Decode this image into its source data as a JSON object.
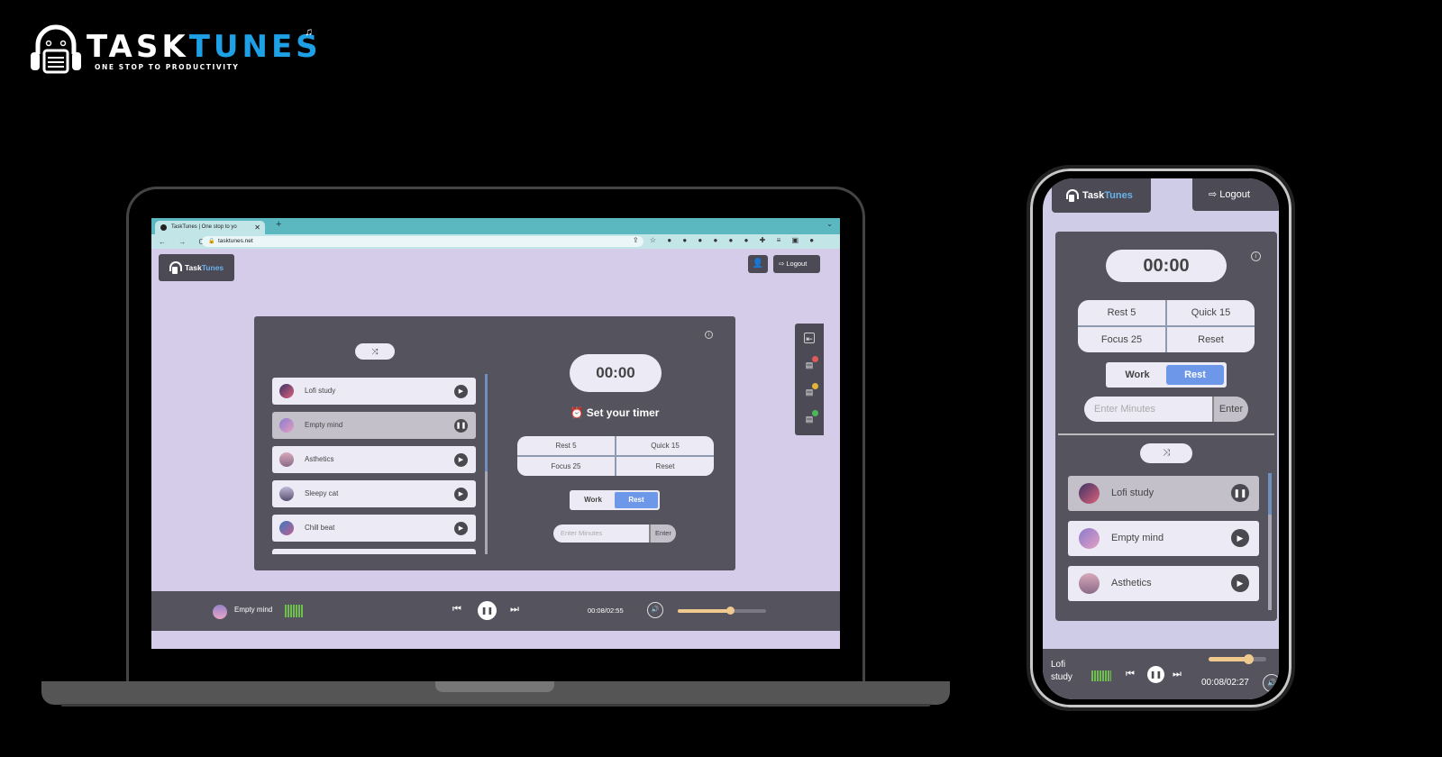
{
  "brand": {
    "title_white": "TASK",
    "title_blue": "TUNES",
    "tagline": "ONE STOP TO PRODUCTIVITY",
    "notes_icon": "♫"
  },
  "colors": {
    "accent_blue": "#6d97e8",
    "brand_blue": "#1ea0e6",
    "panel": "#55535d",
    "page_bg": "#d5cce9",
    "slider": "#f0c98e"
  },
  "browser": {
    "tab_title": "TaskTunes | One stop to yo",
    "tab_close": "✕",
    "new_tab": "+",
    "tab_menu": "⌄",
    "nav": "← → C",
    "url": "tasktunes.net",
    "lock": "🔒",
    "extensions": "⇪ ☆ ● ● ● ● ● ● ✚ ≡ ▣ ●"
  },
  "desktop": {
    "logo_a": "Task",
    "logo_b": "Tunes",
    "user_icon": "👤",
    "logout_label": "⇨ Logout",
    "shuffle_icon": "⤨",
    "info_icon": "i",
    "timer": "00:00",
    "set_timer": "⏰ Set your timer",
    "presets": [
      "Rest 5",
      "Quick 15",
      "Focus 25",
      "Reset"
    ],
    "mode": {
      "work": "Work",
      "rest": "Rest",
      "selected": "Rest"
    },
    "minutes_placeholder": "Enter Minutes",
    "enter_label": "Enter",
    "songs": [
      {
        "name": "Lofi study",
        "state": "play",
        "icon": "▶"
      },
      {
        "name": "Empty mind",
        "state": "pause",
        "icon": "❚❚"
      },
      {
        "name": "Asthetics",
        "state": "play",
        "icon": "▶"
      },
      {
        "name": "Sleepy cat",
        "state": "play",
        "icon": "▶"
      },
      {
        "name": "Chill beat",
        "state": "play",
        "icon": "▶"
      }
    ],
    "sidebar": {
      "collapse_icon": "⇤",
      "items": [
        {
          "icon": "📋",
          "badge": "#e05a5a"
        },
        {
          "icon": "📋",
          "badge": "#e3b43c"
        },
        {
          "icon": "📋",
          "badge": "#4bb85a"
        }
      ]
    },
    "player": {
      "now_playing": "Empty mind",
      "prev_icon": "⏮",
      "pause_icon": "❚❚",
      "next_icon": "⏭",
      "time": "00:08/02:55",
      "volume_icon": "🔊",
      "volume_percent": 60
    }
  },
  "mobile": {
    "logo_a": "Task",
    "logo_b": "Tunes",
    "logout_label": "⇨  Logout",
    "info_icon": "i",
    "timer": "00:00",
    "presets": [
      "Rest 5",
      "Quick 15",
      "Focus 25",
      "Reset"
    ],
    "mode": {
      "work": "Work",
      "rest": "Rest",
      "selected": "Rest"
    },
    "minutes_placeholder": "Enter Minutes",
    "enter_label": "Enter",
    "shuffle_icon": "⤨",
    "songs": [
      {
        "name": "Lofi study",
        "state": "pause",
        "icon": "❚❚"
      },
      {
        "name": "Empty mind",
        "state": "play",
        "icon": "▶"
      },
      {
        "name": "Asthetics",
        "state": "play",
        "icon": "▶"
      }
    ],
    "player": {
      "now_playing": "Lofi study",
      "prev_icon": "⏮",
      "pause_icon": "❚❚",
      "next_icon": "⏭",
      "time": "00:08/02:27",
      "volume_icon": "🔊",
      "volume_percent": 68
    }
  }
}
